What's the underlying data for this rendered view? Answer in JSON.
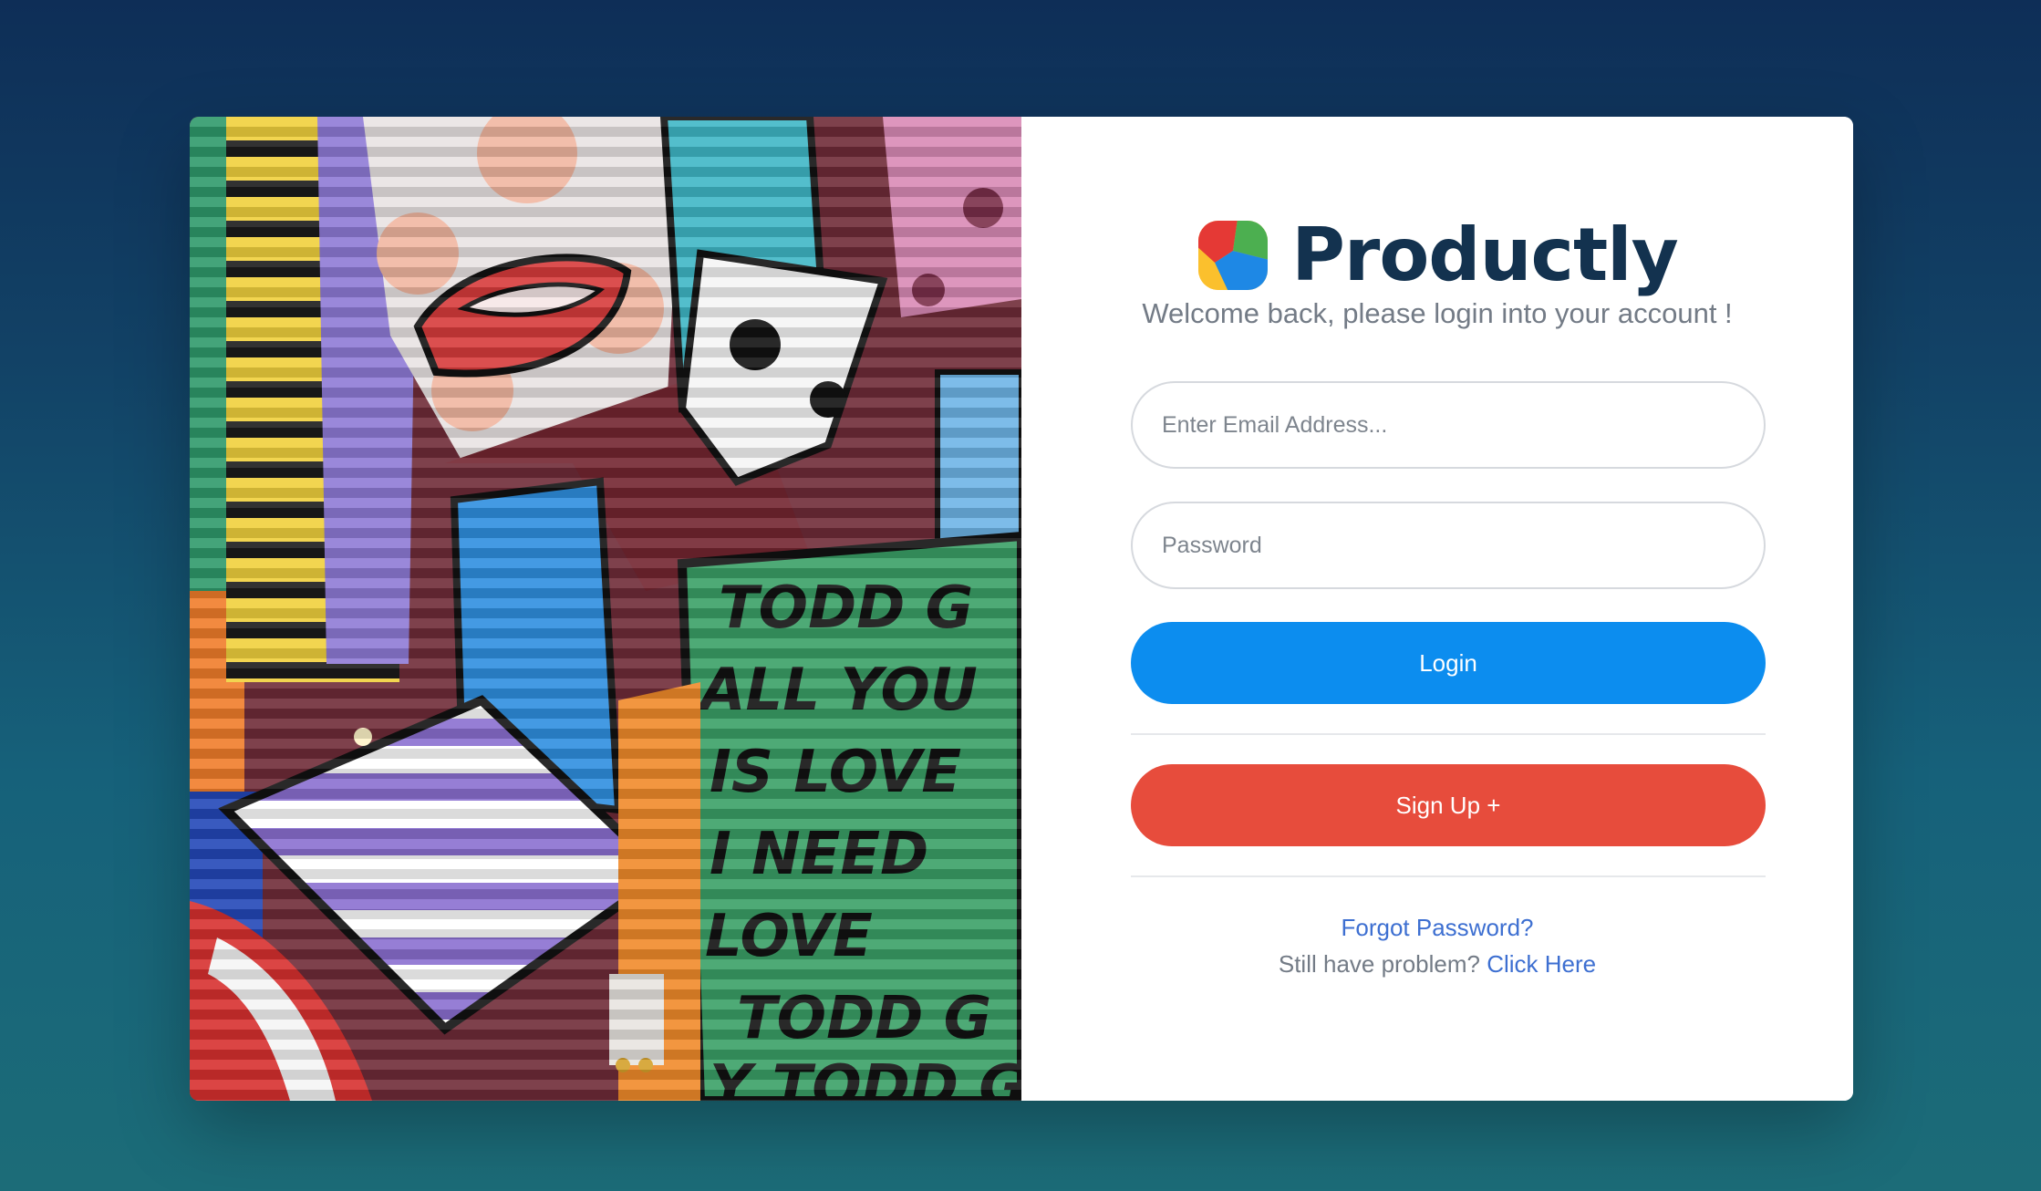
{
  "brand": {
    "name": "Productly",
    "logo_icon": "productly-logo-icon",
    "colors": [
      "#e53935",
      "#4caf50",
      "#fbc02d",
      "#1e88e5"
    ]
  },
  "welcome_text": "Welcome back, please login into your account !",
  "form": {
    "email_placeholder": "Enter Email Address...",
    "email_value": "",
    "password_placeholder": "Password",
    "password_value": "",
    "login_label": "Login",
    "signup_label": "Sign Up +"
  },
  "help": {
    "forgot_password_link": "Forgot Password?",
    "problem_text": "Still have problem?",
    "click_here_link": "Click Here"
  },
  "art_image": {
    "icon": "mural-graffiti-image",
    "visible_text": [
      "TODD G",
      "ALL YOU",
      "IS LOVE",
      "I NEED",
      "LOVE",
      "TODD G",
      "Y TODD G"
    ]
  },
  "theme": {
    "primary": "#0c8def",
    "danger": "#e74c3c",
    "brand_dark": "#13324f",
    "link": "#3d6fd1"
  }
}
